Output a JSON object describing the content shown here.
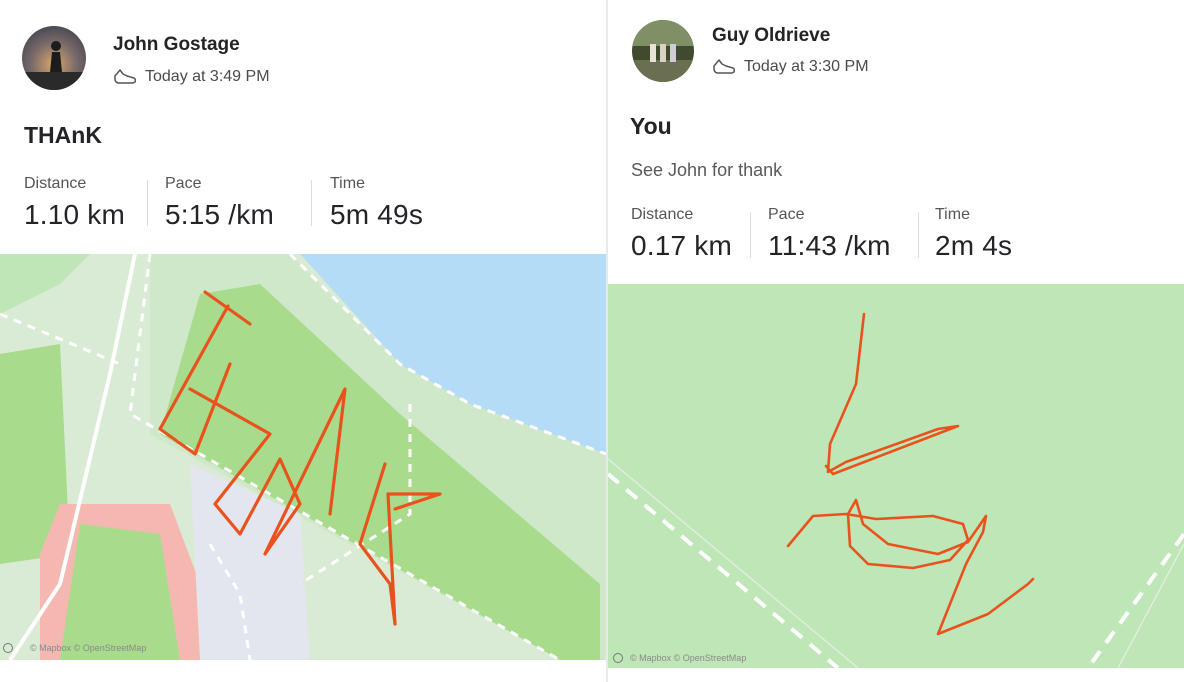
{
  "left": {
    "athlete": {
      "name": "John Gostage",
      "timestamp": "Today at 3:49 PM",
      "avatar_icon": "avatar-silhouette"
    },
    "activity": {
      "title": "THAnK",
      "activity_icon": "shoe-icon"
    },
    "stats": [
      {
        "label": "Distance",
        "value": "1.10 km"
      },
      {
        "label": "Pace",
        "value": "5:15 /km"
      },
      {
        "label": "Time",
        "value": "5m 49s"
      }
    ],
    "map": {
      "attribution": "© Mapbox © OpenStreetMap",
      "route_color": "#e9521d"
    }
  },
  "right": {
    "athlete": {
      "name": "Guy Oldrieve",
      "timestamp": "Today at 3:30 PM",
      "avatar_icon": "avatar-group-photo"
    },
    "activity": {
      "title": "You",
      "description": "See John for thank",
      "activity_icon": "shoe-icon"
    },
    "stats": [
      {
        "label": "Distance",
        "value": "0.17 km"
      },
      {
        "label": "Pace",
        "value": "11:43 /km"
      },
      {
        "label": "Time",
        "value": "2m 4s"
      }
    ],
    "map": {
      "attribution": "© Mapbox © OpenStreetMap",
      "route_color": "#e9521d"
    }
  },
  "colors": {
    "park_green": "#bfe6b6",
    "bright_green": "#a8dc8c",
    "water_blue": "#b4dcf6",
    "track_red": "#f4b8b0"
  }
}
